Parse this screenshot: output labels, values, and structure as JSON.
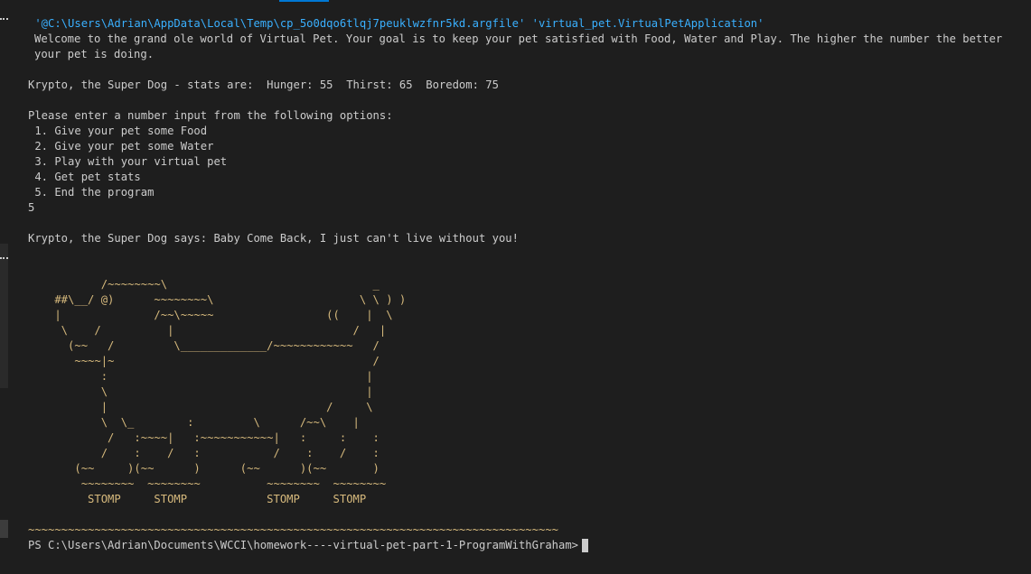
{
  "command_line": " '@C:\\Users\\Adrian\\AppData\\Local\\Temp\\cp_5o0dqo6tlqj7peuklwzfnr5kd.argfile' 'virtual_pet.VirtualPetApplication'",
  "intro_text": "Welcome to the grand ole world of Virtual Pet. Your goal is to keep your pet satisfied with Food, Water and Play. The higher the number the better your pet is doing.",
  "stats_line": "Krypto, the Super Dog - stats are:  Hunger: 55  Thirst: 65  Boredom: 75",
  "options_prompt": "Please enter a number input from the following options:",
  "options": [
    " 1. Give your pet some Food",
    " 2. Give your pet some Water",
    " 3. Play with your virtual pet",
    " 4. Get pet stats",
    " 5. End the program"
  ],
  "user_input": "5",
  "pet_says": "Krypto, the Super Dog says: Baby Come Back, I just can't live without you!",
  "ascii_art": "           /~~~~~~~~\\                               _\n    ##\\__/ @)      ~~~~~~~~\\                      \\ \\ ) )\n    |              /~~\\~~~~~                 ((    |  \\\n     \\    /          |                           /   |\n      (~~   /         \\_____________/~~~~~~~~~~~~   /\n       ~~~~|~                                       /\n           :                                       |\n           \\                                       |\n           |                                 /     \\\n           \\  \\_        :         \\      /~~\\    |\n            /   :~~~~|   :~~~~~~~~~~~|   :     :    :\n           /    :    /   :           /    :    /    :\n       (~~     )(~~      )      (~~      )(~~       )\n        ~~~~~~~~  ~~~~~~~~          ~~~~~~~~  ~~~~~~~~\n         STOMP     STOMP            STOMP     STOMP",
  "separator": "~~~~~~~~~~~~~~~~~~~~~~~~~~~~~~~~~~~~~~~~~~~~~~~~~~~~~~~~~~~~~~~~~~~~~~~~~~~~~~~~",
  "prompt": "PS C:\\Users\\Adrian\\Documents\\WCCI\\homework----virtual-pet-part-1-ProgramWithGraham>",
  "colors": {
    "background": "#1e1e1e",
    "text": "#cccccc",
    "command": "#3ab0ff",
    "art": "#d7ba7d",
    "accent_tab": "#0078d4"
  }
}
